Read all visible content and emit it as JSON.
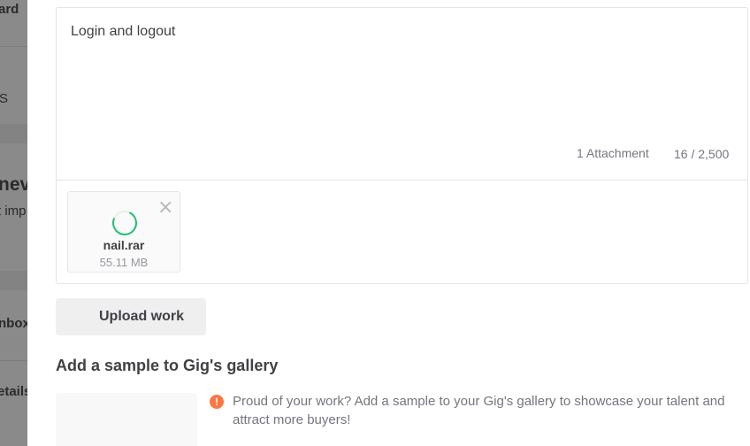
{
  "background_page": {
    "fragments": [
      "ard",
      "S",
      "nev",
      "t imp",
      "nbox",
      "etails"
    ]
  },
  "message": {
    "text": "Login and logout",
    "attachment_count": "1 Attachment",
    "char_count": "16 / 2,500"
  },
  "attachment": {
    "name": "nail.rar",
    "size": "55.11 MB",
    "status_icon": "loading-spinner-icon",
    "remove_icon": "close-icon",
    "spinner_color": "#1dbf73"
  },
  "upload_button": {
    "label": "Upload work"
  },
  "gallery": {
    "title": "Add a sample to Gig's gallery",
    "info_icon": "exclamation-icon",
    "info_text": "Proud of your work? Add a sample to your Gig's gallery to showcase your talent and attract more buyers!",
    "info_color": "#ff7640"
  }
}
